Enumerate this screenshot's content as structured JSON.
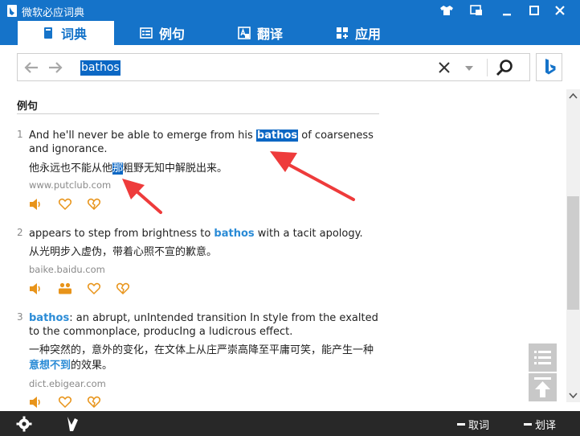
{
  "app": {
    "title": "微软必应词典",
    "accent_color": "#1573c9",
    "annotation_color": "#ee3b3b"
  },
  "titlebar": {
    "buttons": [
      {
        "name": "theme-shirt-icon"
      },
      {
        "name": "mini-mode-icon"
      },
      {
        "name": "minimize-icon"
      },
      {
        "name": "maximize-icon"
      },
      {
        "name": "close-icon"
      }
    ]
  },
  "tabs": [
    {
      "label": "词典",
      "icon": "book-icon",
      "active": true
    },
    {
      "label": "例句",
      "icon": "list-icon",
      "active": false
    },
    {
      "label": "翻译",
      "icon": "translate-icon",
      "active": false
    },
    {
      "label": "应用",
      "icon": "apps-icon",
      "active": false
    }
  ],
  "search": {
    "query": "bathos"
  },
  "section": {
    "title": "例句"
  },
  "examples": [
    {
      "num": "1",
      "en_before": "And he'll never be able to emerge from his ",
      "en_kw": "bathos",
      "en_after": " of coarseness and ignorance.",
      "cn_before": "他永远也不能从他",
      "cn_hl": "那",
      "cn_after": "粗野无知中解脱出来。",
      "source": "www.putclub.com"
    },
    {
      "num": "2",
      "en_before": "appears to step from brightness to ",
      "en_kw": "bathos",
      "en_after": " with a tacit apology.",
      "cn_text": "从光明步入虚伪，带着心照不宣的歉意。",
      "source": "baike.baidu.com"
    },
    {
      "num": "3",
      "en_kw": "bathos",
      "en_after": ": an abrupt, unIntended transition In style from the exalted to the commonplace, producIng a ludicrous effect.",
      "cn_line1": "一种突然的，意外的变化，在文体上从庄严崇高降至平庸可笑，能产生一种",
      "cn_kw": "意想不到",
      "cn_after": "的效果。",
      "source": "dict.ebigear.com"
    }
  ],
  "bottombar": {
    "cancel_label": "取词",
    "select_translate_label": "划译"
  }
}
